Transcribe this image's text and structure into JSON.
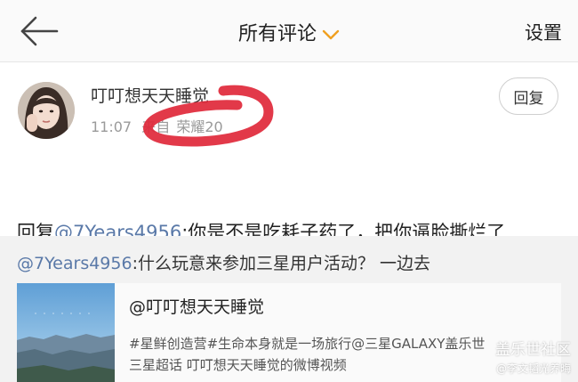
{
  "header": {
    "title": "所有评论",
    "settings_label": "设置"
  },
  "comment": {
    "username": "叮叮想天天睡觉",
    "time": "11:07",
    "source_prefix": "来自",
    "device": "荣耀20",
    "reply_button": "回复",
    "reply_prefix": "回复",
    "mention": "@7Years4956",
    "text": ":你是不是吃耗子药了，把你逼脸撕烂了"
  },
  "quoted": {
    "mention": "@7Years4956",
    "text": ":什么玩意来参加三星用户活动？ 一边去",
    "card": {
      "title": "@叮叮想天天睡觉",
      "desc_line1": "#星鲜创造营#生命本身就是一场旅行@三星GALAXY盖乐世",
      "desc_line2": "三星超话 叮叮想天天睡觉的微博视频"
    }
  },
  "watermark": {
    "line1": "盖乐世社区",
    "line2": "@李文韬光养晦"
  },
  "colors": {
    "accent": "#f0a020",
    "mention": "#5a79a8",
    "annotation": "#e0283a"
  }
}
